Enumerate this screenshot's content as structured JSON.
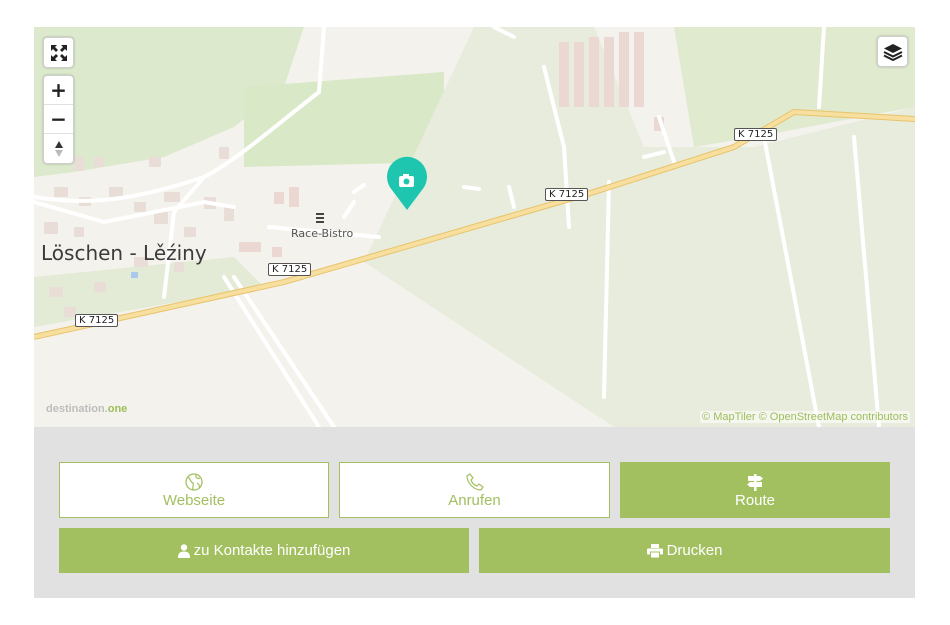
{
  "map": {
    "town_label": "Löschen - Lěźiny",
    "poi_label": "Race-Bistro",
    "road_shields": [
      "K 7125",
      "K 7125",
      "K 7125",
      "K 7125"
    ],
    "brand_text": "destination.",
    "brand_accent": "one",
    "attribution": "© MapTiler © OpenStreetMap contributors",
    "controls": {
      "fullscreen_icon": "expand-icon",
      "zoom_in": "+",
      "zoom_out": "−",
      "layers_icon": "layers-icon"
    },
    "marker_icon": "camera-icon",
    "colors": {
      "marker": "#1ec6b0",
      "road": "#f6d58a",
      "green": "#d9e8c7"
    }
  },
  "actions": {
    "website": {
      "label": "Webseite",
      "icon": "globe-icon"
    },
    "call": {
      "label": "Anrufen",
      "icon": "phone-icon"
    },
    "route": {
      "label": "Route",
      "icon": "signpost-icon"
    },
    "add_contact": {
      "label": "zu Kontakte hinzufügen",
      "icon": "user-icon"
    },
    "print": {
      "label": "Drucken",
      "icon": "printer-icon"
    }
  },
  "colors": {
    "accent": "#a2c05f",
    "panel_bg": "#e1e1e1"
  }
}
